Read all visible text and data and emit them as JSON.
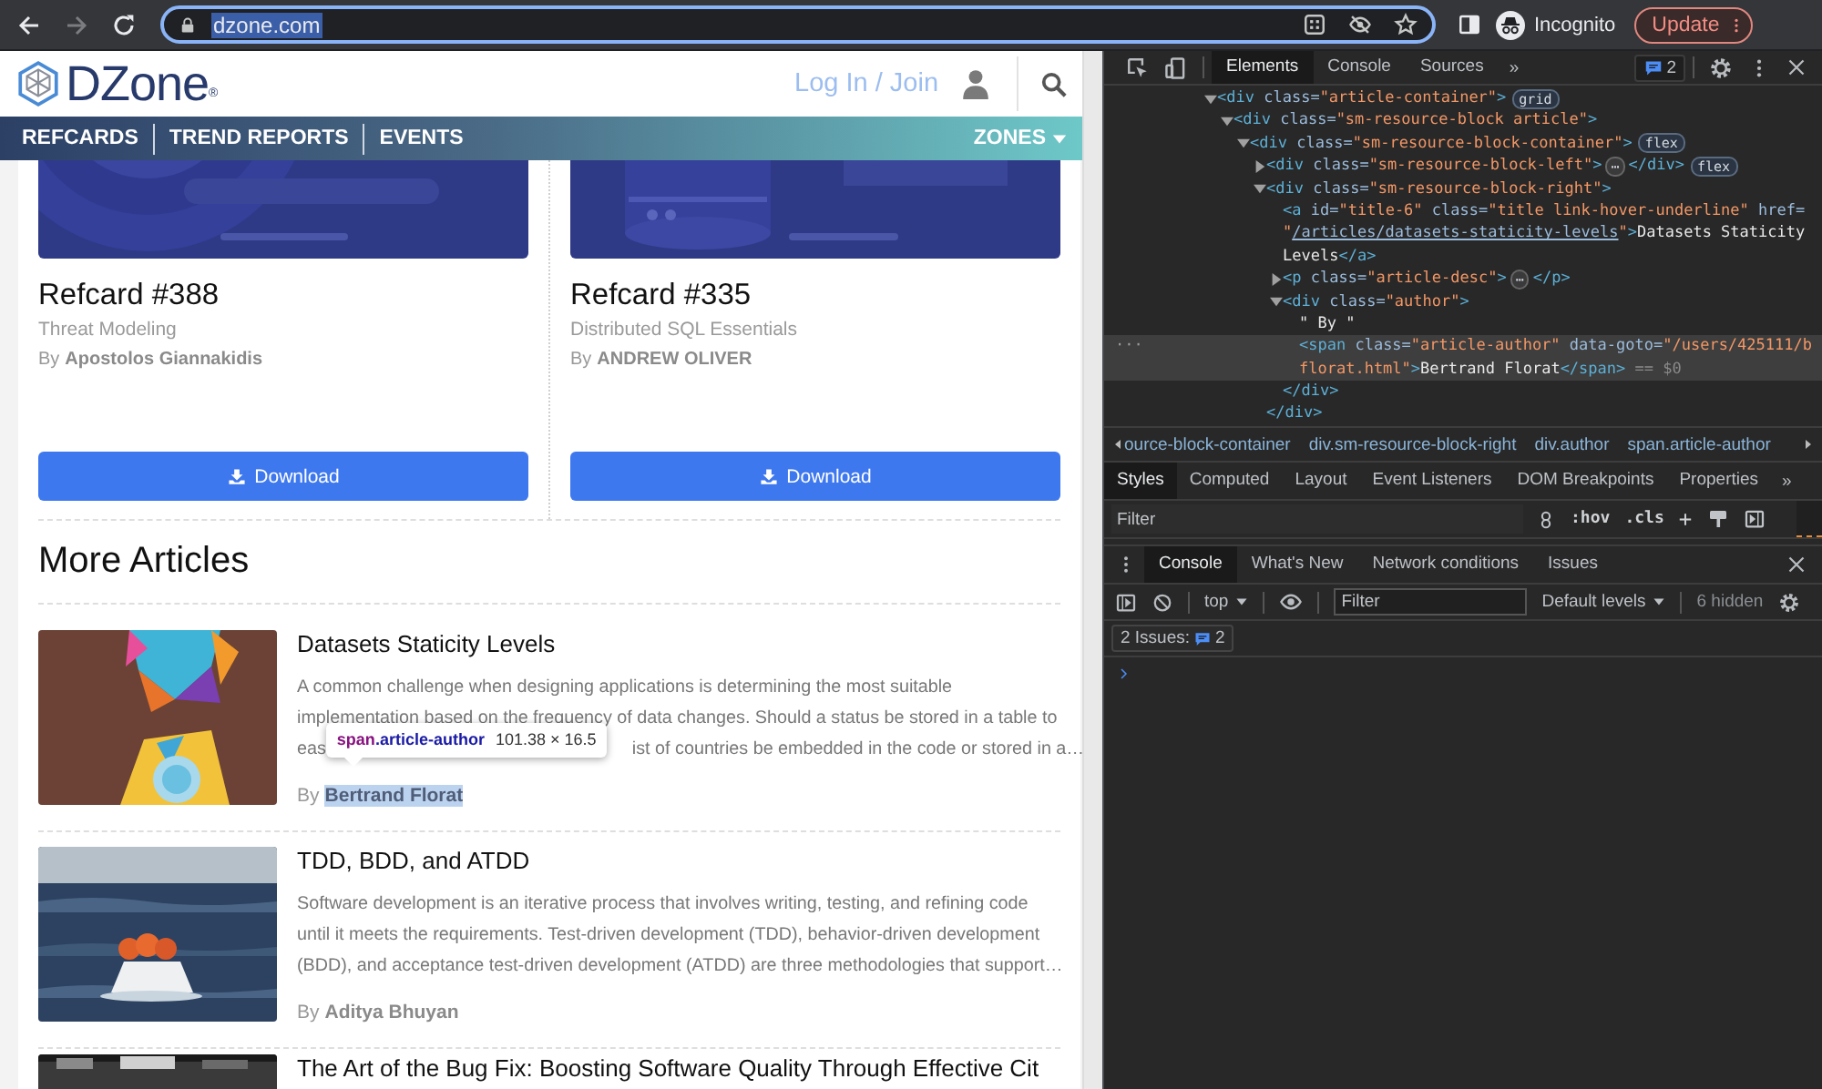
{
  "browser": {
    "nav_buttons": [
      {
        "kind": "back",
        "disabled": false
      },
      {
        "kind": "forward",
        "disabled": true
      },
      {
        "kind": "reload",
        "disabled": false
      }
    ],
    "address": {
      "text": "dzone.com",
      "selected": true
    },
    "profile": "Incognito",
    "update_button": "Update"
  },
  "page": {
    "header": {
      "logo": "DZone",
      "logo_mark": "®",
      "login": "Log In / Join"
    },
    "nav": {
      "items": [
        "REFCARDS",
        "TREND REPORTS",
        "EVENTS"
      ],
      "zones": "ZONES"
    },
    "refcards": [
      {
        "cover": {
          "kind": "picture"
        },
        "title": "Refcard #388",
        "subtitle": "Threat Modeling",
        "by": "By",
        "author": "Apostolos Giannakidis",
        "button": "Download"
      },
      {
        "cover": {
          "kind": "picture"
        },
        "title": "Refcard #335",
        "subtitle": "Distributed SQL Essentials",
        "by": "By",
        "author": "ANDREW OLIVER",
        "button": "Download"
      }
    ],
    "more_heading": "More Articles",
    "articles": [
      {
        "image": {
          "kind": "picture"
        },
        "title": "Datasets Staticity Levels",
        "description_lines": [
          [
            "A common challenge when designing applications is determining the most suitable"
          ],
          [
            "implementation based on the frequency of data changes. Should a status be stored in a table to"
          ],
          [
            "eas",
            "ist of countries be embedded in the code or stored in a…"
          ]
        ],
        "by": "By",
        "author": "Bertrand Florat",
        "highlighted": true
      },
      {
        "image": {
          "kind": "picture"
        },
        "title": "TDD, BDD, and ATDD",
        "description_lines": [
          [
            "Software development is an iterative process that involves writing, testing, and refining code"
          ],
          [
            "until it meets the requirements. Test-driven development (TDD), behavior-driven development"
          ],
          [
            "(BDD), and acceptance test-driven development (ATDD) are three methodologies that support…"
          ]
        ],
        "by": "By",
        "author": "Aditya Bhuyan",
        "highlighted": false
      },
      {
        "image": {
          "kind": "picture"
        },
        "title": "The Art of the Bug Fix: Boosting Software Quality Through Effective Cit"
      }
    ],
    "tooltip": {
      "tag": "span",
      "class": ".article-author",
      "size": "101.38 × 16.5"
    }
  },
  "devtools": {
    "tabs": [
      {
        "label": "Elements",
        "selected": true
      },
      {
        "label": "Console",
        "selected": false
      },
      {
        "label": "Sources",
        "selected": false
      }
    ],
    "more": "»",
    "issues_count": "2",
    "dom": [
      {
        "selected": false,
        "expanded": true,
        "lines": [
          [
            {
              "kind": "tag",
              "text": "<div"
            },
            {
              "kind": "attr",
              "text": " class="
            },
            {
              "kind": "value",
              "text": "\"article-container\""
            },
            {
              "kind": "tag",
              "text": ">"
            },
            {
              "kind": "badge",
              "text": "grid"
            }
          ]
        ],
        "children": [
          {
            "selected": false,
            "expanded": true,
            "lines": [
              [
                {
                  "kind": "tag",
                  "text": "<div"
                },
                {
                  "kind": "attr",
                  "text": " class="
                },
                {
                  "kind": "value",
                  "text": "\"sm-resource-block article\""
                },
                {
                  "kind": "tag",
                  "text": ">"
                }
              ]
            ],
            "children": [
              {
                "selected": false,
                "expanded": true,
                "lines": [
                  [
                    {
                      "kind": "tag",
                      "text": "<div"
                    },
                    {
                      "kind": "attr",
                      "text": " class="
                    },
                    {
                      "kind": "value",
                      "text": "\"sm-resource-block-container\""
                    },
                    {
                      "kind": "tag",
                      "text": ">"
                    },
                    {
                      "kind": "badge",
                      "text": "flex"
                    }
                  ]
                ],
                "children": [
                  {
                    "selected": false,
                    "expanded": false,
                    "lines": [
                      [
                        {
                          "kind": "tag",
                          "text": "<div"
                        },
                        {
                          "kind": "attr",
                          "text": " class="
                        },
                        {
                          "kind": "value",
                          "text": "\"sm-resource-block-left\""
                        },
                        {
                          "kind": "tag",
                          "text": ">"
                        },
                        {
                          "kind": "ellipsis",
                          "text": "⋯"
                        },
                        {
                          "kind": "tag",
                          "text": "</div>"
                        },
                        {
                          "kind": "badge",
                          "text": "flex"
                        }
                      ]
                    ]
                  },
                  {
                    "selected": false,
                    "expanded": true,
                    "lines": [
                      [
                        {
                          "kind": "tag",
                          "text": "<div"
                        },
                        {
                          "kind": "attr",
                          "text": " class="
                        },
                        {
                          "kind": "value",
                          "text": "\"sm-resource-block-right\""
                        },
                        {
                          "kind": "tag",
                          "text": ">"
                        }
                      ]
                    ],
                    "children": [
                      {
                        "selected": false,
                        "lines": [
                          [
                            {
                              "kind": "tag",
                              "text": "<a"
                            },
                            {
                              "kind": "attr",
                              "text": " id="
                            },
                            {
                              "kind": "value",
                              "text": "\"title-6\""
                            },
                            {
                              "kind": "attr",
                              "text": " class="
                            },
                            {
                              "kind": "value",
                              "text": "\"title link-hover-underline\""
                            },
                            {
                              "kind": "attr",
                              "text": " href="
                            }
                          ],
                          [
                            {
                              "kind": "value",
                              "text": "\""
                            },
                            {
                              "kind": "link",
                              "text": "/articles/datasets-staticity-levels"
                            },
                            {
                              "kind": "value",
                              "text": "\""
                            },
                            {
                              "kind": "tag",
                              "text": ">"
                            },
                            {
                              "kind": "text",
                              "text": "Datasets Staticity"
                            }
                          ],
                          [
                            {
                              "kind": "text",
                              "text": "Levels"
                            },
                            {
                              "kind": "tag",
                              "text": "</a>"
                            }
                          ]
                        ]
                      },
                      {
                        "selected": false,
                        "expanded": false,
                        "lines": [
                          [
                            {
                              "kind": "tag",
                              "text": "<p"
                            },
                            {
                              "kind": "attr",
                              "text": " class="
                            },
                            {
                              "kind": "value",
                              "text": "\"article-desc\""
                            },
                            {
                              "kind": "tag",
                              "text": ">"
                            },
                            {
                              "kind": "ellipsis",
                              "text": "⋯"
                            },
                            {
                              "kind": "tag",
                              "text": "</p>"
                            }
                          ]
                        ]
                      },
                      {
                        "selected": false,
                        "expanded": true,
                        "lines": [
                          [
                            {
                              "kind": "tag",
                              "text": "<div"
                            },
                            {
                              "kind": "attr",
                              "text": " class="
                            },
                            {
                              "kind": "value",
                              "text": "\"author\""
                            },
                            {
                              "kind": "tag",
                              "text": ">"
                            }
                          ]
                        ],
                        "children": [
                          {
                            "selected": false,
                            "lines": [
                              [
                                {
                                  "kind": "text",
                                  "text": "\" By \""
                                }
                              ]
                            ]
                          },
                          {
                            "selected": true,
                            "gutter": "···",
                            "lines": [
                              [
                                {
                                  "kind": "tag",
                                  "text": "<span"
                                },
                                {
                                  "kind": "attr",
                                  "text": " class="
                                },
                                {
                                  "kind": "value",
                                  "text": "\"article-author\""
                                },
                                {
                                  "kind": "attr",
                                  "text": " data-goto="
                                },
                                {
                                  "kind": "value",
                                  "text": "\"/users/425111/b"
                                }
                              ],
                              [
                                {
                                  "kind": "value",
                                  "text": "florat.html\""
                                },
                                {
                                  "kind": "tag",
                                  "text": ">"
                                },
                                {
                                  "kind": "text",
                                  "text": "Bertrand Florat"
                                },
                                {
                                  "kind": "tag",
                                  "text": "</span>"
                                },
                                {
                                  "kind": "hint",
                                  "text": " == $0"
                                }
                              ]
                            ]
                          }
                        ],
                        "close": [
                          {
                            "kind": "tag",
                            "text": "</div>"
                          }
                        ]
                      }
                    ],
                    "close": [
                      {
                        "kind": "tag",
                        "text": "</div>"
                      }
                    ]
                  }
                ]
              }
            ]
          }
        ]
      }
    ],
    "breadcrumbs": [
      "ource-block-container",
      "div.sm-resource-block-right",
      "div.author",
      "span.article-author"
    ],
    "style_tabs": [
      {
        "label": "Styles",
        "selected": true
      },
      {
        "label": "Computed",
        "selected": false
      },
      {
        "label": "Layout",
        "selected": false
      },
      {
        "label": "Event Listeners",
        "selected": false
      },
      {
        "label": "DOM Breakpoints",
        "selected": false
      },
      {
        "label": "Properties",
        "selected": false
      }
    ],
    "style_more": "»",
    "styles_filter": {
      "placeholder": "Filter"
    },
    "hov": ":hov",
    "cls": ".cls",
    "plus": "+",
    "drawer_tabs": [
      {
        "label": "Console",
        "selected": true
      },
      {
        "label": "What's New",
        "selected": false
      },
      {
        "label": "Network conditions",
        "selected": false
      },
      {
        "label": "Issues",
        "selected": false
      }
    ],
    "context": "top",
    "console_filter": {
      "placeholder": "Filter"
    },
    "levels": "Default levels",
    "hidden": "6 hidden",
    "issues_label": "2 Issues:",
    "issues_badge": "2"
  }
}
